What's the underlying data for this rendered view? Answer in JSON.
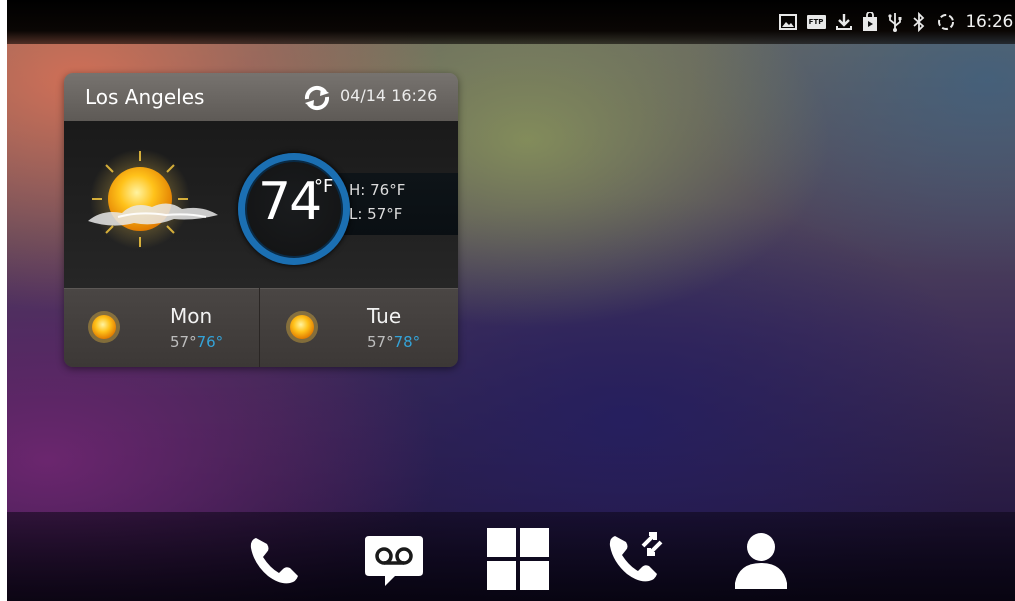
{
  "status_bar": {
    "icons": [
      "image-icon",
      "ftp-icon",
      "download-icon",
      "play-store-icon",
      "usb-icon",
      "bluetooth-icon",
      "sync-icon"
    ],
    "ftp_label": "FTP",
    "time": "16:26"
  },
  "weather_widget": {
    "city": "Los Angeles",
    "updated": "04/14 16:26",
    "current_temp": "74",
    "unit": "°F",
    "condition_icon": "partly-cloudy-sun-icon",
    "high": "H:  76°F",
    "low": "L:   57°F",
    "forecast": [
      {
        "day": "Mon",
        "low": "57°",
        "high": "76°",
        "icon": "sun-icon"
      },
      {
        "day": "Tue",
        "low": "57°",
        "high": "78°",
        "icon": "sun-icon"
      }
    ],
    "colors": {
      "high_temp": "#34a3d8",
      "ring": "#1b6fb2"
    }
  },
  "dock": {
    "items": [
      {
        "name": "phone-icon"
      },
      {
        "name": "voicemail-icon"
      },
      {
        "name": "apps-icon"
      },
      {
        "name": "call-forward-icon"
      },
      {
        "name": "contacts-icon"
      }
    ]
  }
}
